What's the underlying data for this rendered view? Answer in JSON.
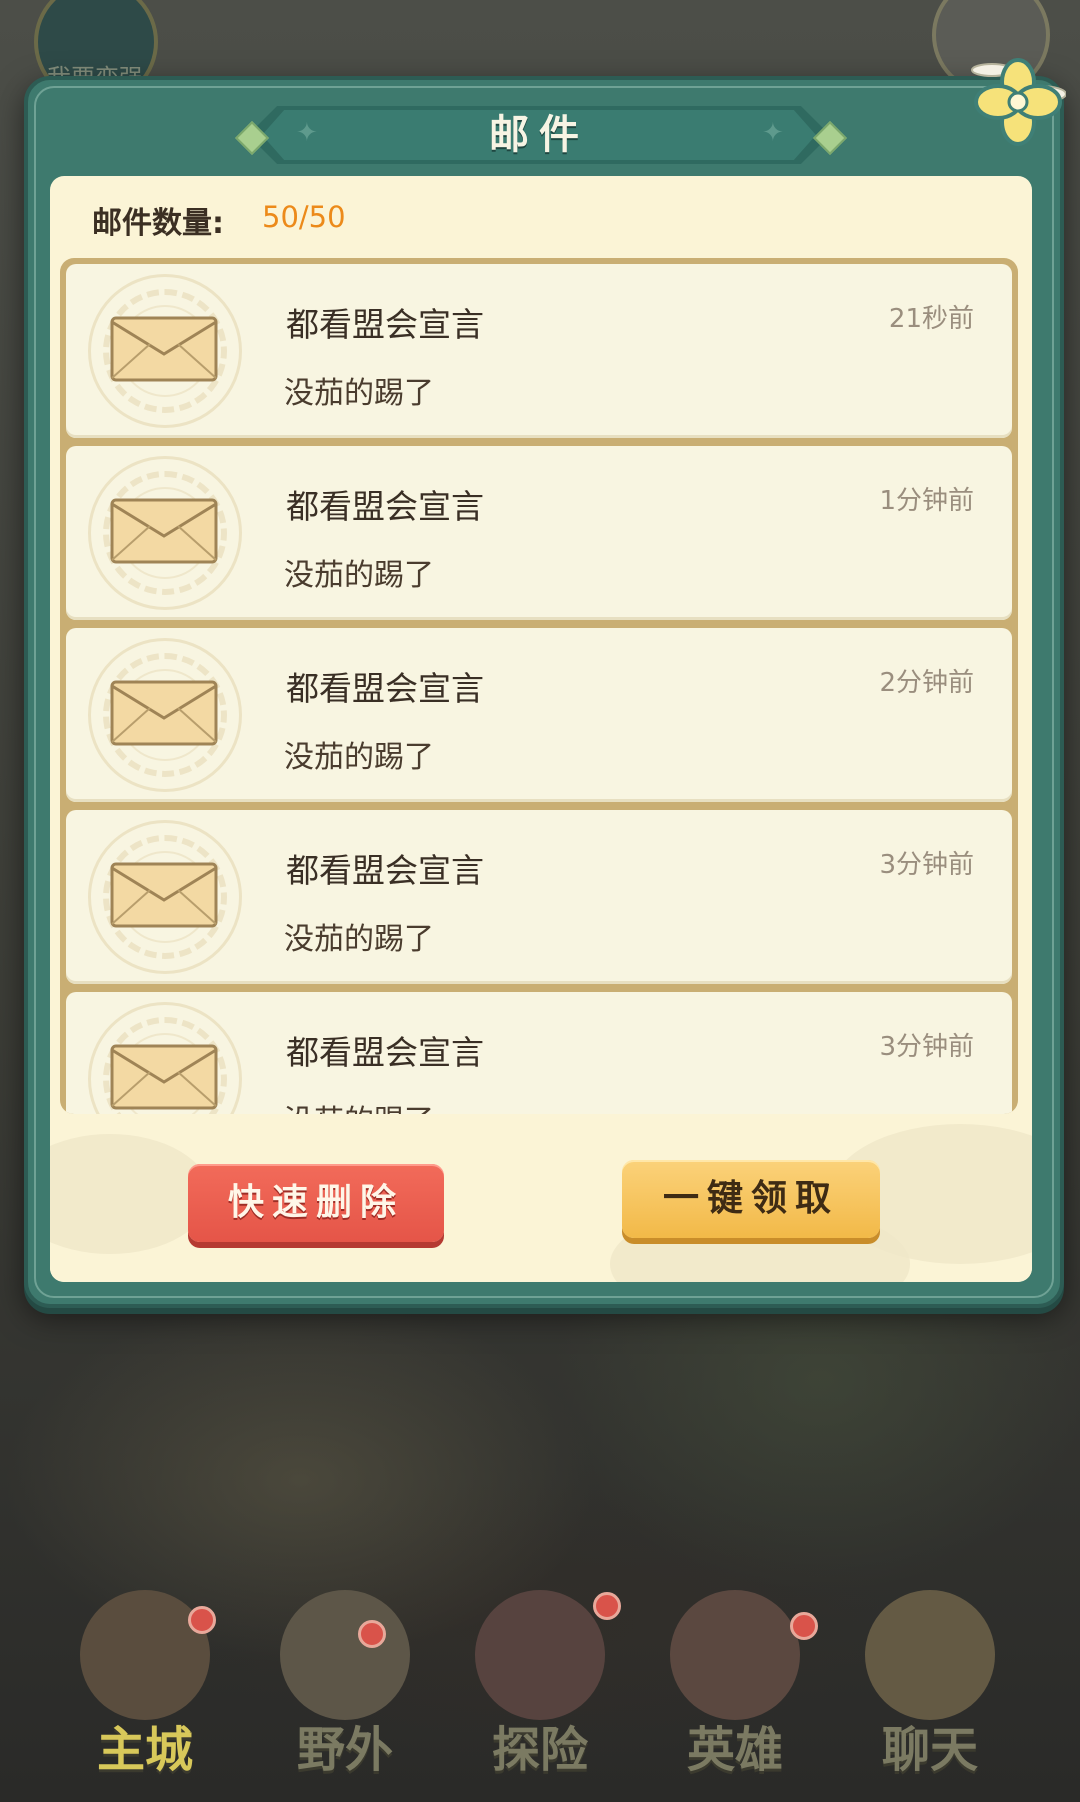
{
  "background": {
    "hud_top_left_label": "我要变强"
  },
  "dialog": {
    "title": "邮件",
    "count_label": "邮件数量:",
    "count_value": "50/50",
    "mails": [
      {
        "title": "都看盟会宣言",
        "subtitle": "没茄的踢了",
        "time": "21秒前"
      },
      {
        "title": "都看盟会宣言",
        "subtitle": "没茄的踢了",
        "time": "1分钟前"
      },
      {
        "title": "都看盟会宣言",
        "subtitle": "没茄的踢了",
        "time": "2分钟前"
      },
      {
        "title": "都看盟会宣言",
        "subtitle": "没茄的踢了",
        "time": "3分钟前"
      },
      {
        "title": "都看盟会宣言",
        "subtitle": "没茄的踢了",
        "time": "3分钟前"
      }
    ],
    "delete_button": "快速删除",
    "claim_button": "一键领取"
  },
  "nav": {
    "items": [
      {
        "label": "主城",
        "icon": "palace-icon"
      },
      {
        "label": "野外",
        "icon": "mountain-icon"
      },
      {
        "label": "探险",
        "icon": "crossed-swords-icon"
      },
      {
        "label": "英雄",
        "icon": "hero-mask-icon"
      },
      {
        "label": "聊天",
        "icon": "chat-faces-icon"
      }
    ]
  },
  "colors": {
    "panel_teal": "#3e7a6e",
    "content_cream": "#fbf4d6",
    "count_orange": "#ec8a1a",
    "delete_red": "#e55548",
    "claim_gold": "#f2b948"
  }
}
